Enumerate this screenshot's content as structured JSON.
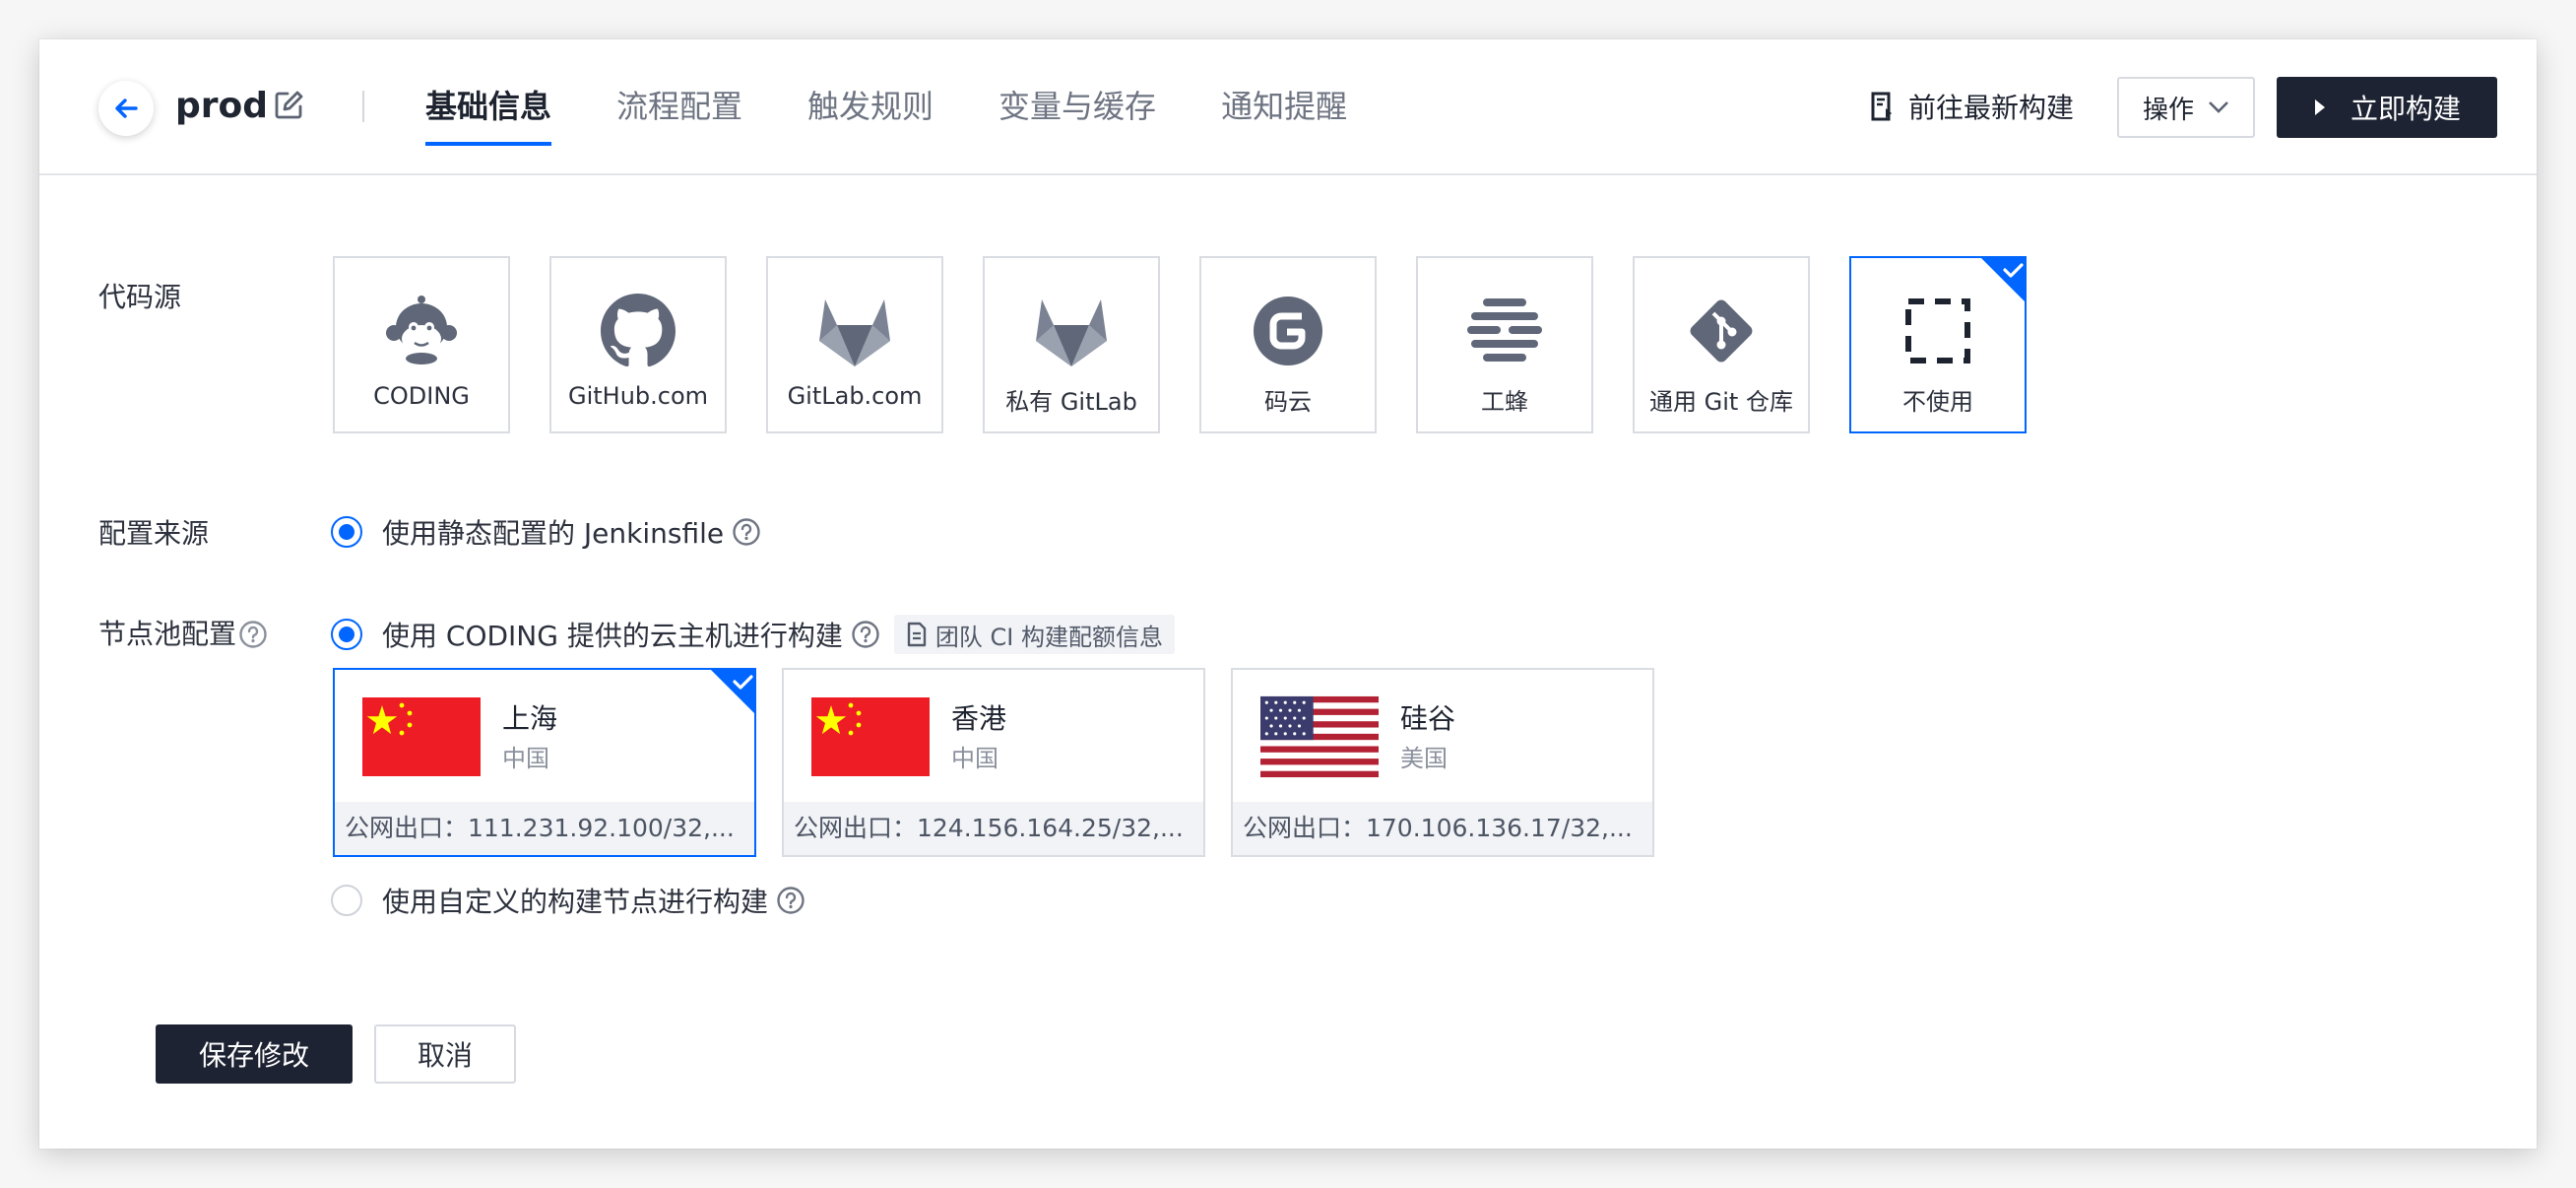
{
  "header": {
    "title": "prod",
    "tabs": [
      {
        "label": "基础信息",
        "active": true
      },
      {
        "label": "流程配置",
        "active": false
      },
      {
        "label": "触发规则",
        "active": false
      },
      {
        "label": "变量与缓存",
        "active": false
      },
      {
        "label": "通知提醒",
        "active": false
      }
    ],
    "latest_build_label": "前往最新构建",
    "ops_label": "操作",
    "build_now_label": "立即构建"
  },
  "form": {
    "code_source_label": "代码源",
    "code_sources": [
      {
        "label": "CODING",
        "icon": "coding-monkey-icon",
        "selected": false
      },
      {
        "label": "GitHub.com",
        "icon": "github-icon",
        "selected": false
      },
      {
        "label": "GitLab.com",
        "icon": "gitlab-icon",
        "selected": false
      },
      {
        "label": "私有 GitLab",
        "icon": "gitlab-icon",
        "selected": false
      },
      {
        "label": "码云",
        "icon": "gitee-icon",
        "selected": false
      },
      {
        "label": "工蜂",
        "icon": "tgit-icon",
        "selected": false
      },
      {
        "label": "通用 Git 仓库",
        "icon": "git-icon",
        "selected": false
      },
      {
        "label": "不使用",
        "icon": "dashed-box-icon",
        "selected": true
      }
    ],
    "config_source_label": "配置来源",
    "config_source_option": "使用静态配置的 Jenkinsfile",
    "node_pool_label": "节点池配置",
    "node_pool_option_cloud": "使用 CODING 提供的云主机进行构建",
    "quota_link_label": "团队 CI 构建配额信息",
    "regions": [
      {
        "name": "上海",
        "country": "中国",
        "egress": "公网出口：111.231.92.100/32,...",
        "flag": "china-flag",
        "selected": true
      },
      {
        "name": "香港",
        "country": "中国",
        "egress": "公网出口：124.156.164.25/32,...",
        "flag": "china-flag",
        "selected": false
      },
      {
        "name": "硅谷",
        "country": "美国",
        "egress": "公网出口：170.106.136.17/32,...",
        "flag": "us-flag",
        "selected": false
      }
    ],
    "node_pool_option_custom": "使用自定义的构建节点进行构建",
    "save_label": "保存修改",
    "cancel_label": "取消"
  },
  "colors": {
    "accent": "#0066ff",
    "primary_button": "#1e2333",
    "border": "#d9dce1"
  }
}
